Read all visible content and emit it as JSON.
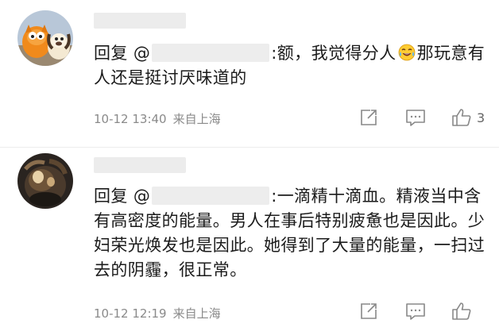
{
  "comments": [
    {
      "reply_prefix": "回复",
      "at_sign": "@",
      "text_part1": ":额，我觉得分人",
      "emoji": "laughing-crying-emoji",
      "text_part2": "那玩意有人还是挺讨厌味道的",
      "date": "10-12 13:40",
      "location": "来自上海",
      "like_count": "3"
    },
    {
      "reply_prefix": "回复",
      "at_sign": "@",
      "text": ":一滴精十滴血。精液当中含有高密度的能量。男人在事后特别疲惫也是因此。少妇荣光焕发也是因此。她得到了大量的能量，一扫过去的阴霾，很正常。",
      "date": "10-12 12:19",
      "location": "来自上海",
      "like_count": ""
    }
  ],
  "colors": {
    "text": "#1b1b1b",
    "mention": "#1b1b1b",
    "meta": "#8a8a8a",
    "icon": "#888888",
    "blur": "#ececec"
  }
}
